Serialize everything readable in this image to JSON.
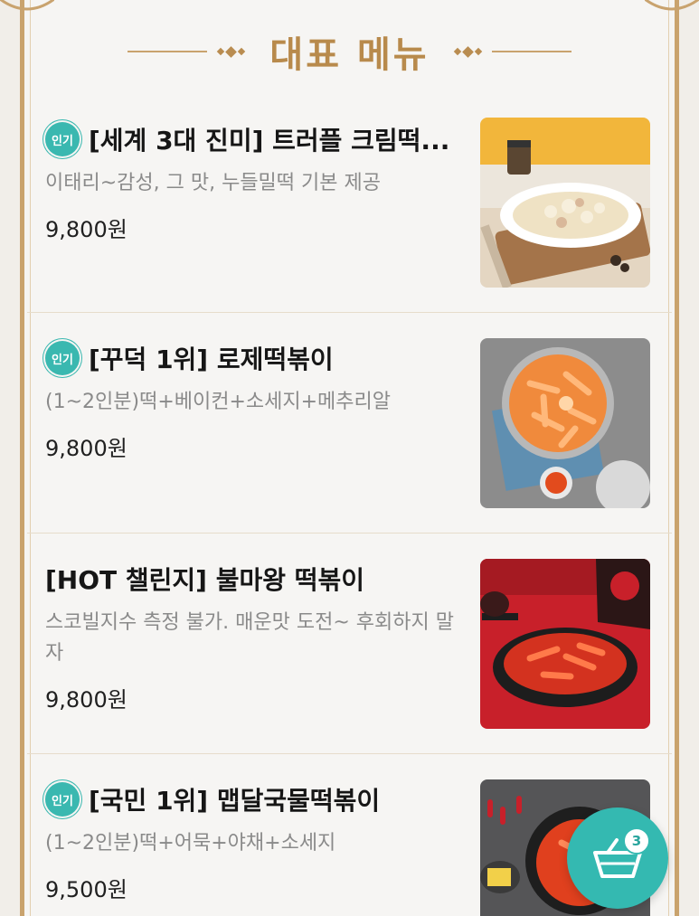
{
  "section": {
    "title": "대표 메뉴"
  },
  "menu": [
    {
      "badge": "인기",
      "name": "[세계 3대 진미] 트러플 크림떡...",
      "description": "이태리~감성, 그 맛, 누들밀떡 기본 제공",
      "price": "9,800원",
      "image": "truffle-cream-tteokbokki-photo"
    },
    {
      "badge": "인기",
      "name": "[꾸덕 1위] 로제떡볶이",
      "description": "(1~2인분)떡+베이컨+소세지+메추리알",
      "price": "9,800원",
      "image": "rose-tteokbokki-photo"
    },
    {
      "badge": "",
      "name": "[HOT 챌린지] 불마왕 떡볶이",
      "description": "스코빌지수 측정 불가. 매운맛 도전~ 후회하지 말자",
      "price": "9,800원",
      "image": "fire-king-tteokbokki-photo"
    },
    {
      "badge": "인기",
      "name": "[국민 1위] 맵달국물떡볶이",
      "description": "(1~2인분)떡+어묵+야채+소세지",
      "price": "9,500원",
      "image": "spicy-sweet-soup-tteokbokki-photo"
    }
  ],
  "cart": {
    "count": "3",
    "icon": "basket-icon"
  },
  "colors": {
    "accent": "#34b9b1",
    "gold": "#c9a36e"
  }
}
